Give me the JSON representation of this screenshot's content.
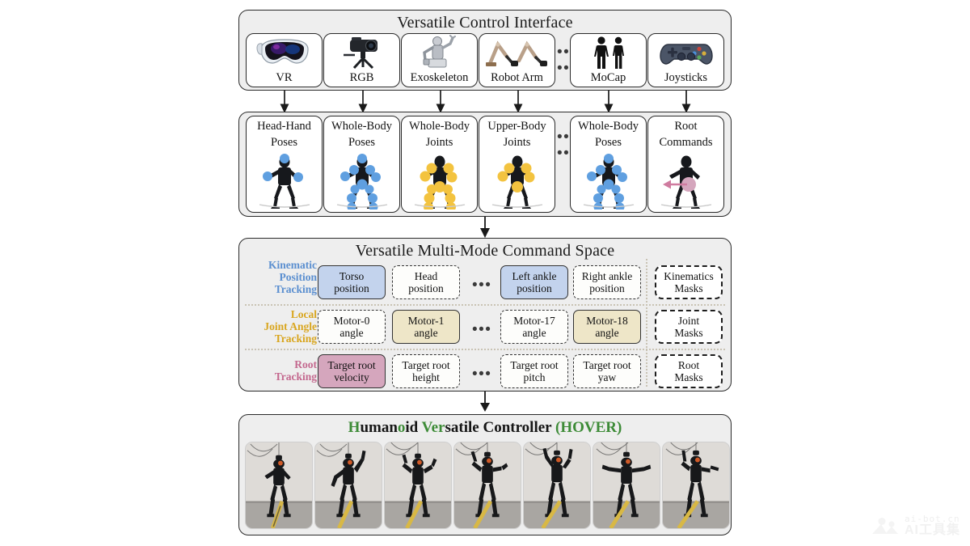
{
  "interface_panel": {
    "title": "Versatile Control Interface",
    "devices": [
      {
        "label": "VR",
        "icon": "vr-headset-icon"
      },
      {
        "label": "RGB",
        "icon": "rgb-camera-icon"
      },
      {
        "label": "Exoskeleton",
        "icon": "exoskeleton-icon"
      },
      {
        "label": "Robot Arm",
        "icon": "robot-arm-icon"
      },
      {
        "label": "MoCap",
        "icon": "mocap-suit-icon"
      },
      {
        "label": "Joysticks",
        "icon": "gamepad-icon"
      }
    ],
    "ellipsis": "•••"
  },
  "pose_panel": {
    "items": [
      {
        "line1": "Head-Hand",
        "line2": "Poses",
        "joint_color": "#5f9fe0",
        "art": "pose-head-hand"
      },
      {
        "line1": "Whole-Body",
        "line2": "Poses",
        "joint_color": "#5f9fe0",
        "art": "pose-whole-body"
      },
      {
        "line1": "Whole-Body",
        "line2": "Joints",
        "joint_color": "#f3c33f",
        "art": "pose-whole-body-joints"
      },
      {
        "line1": "Upper-Body",
        "line2": "Joints",
        "joint_color": "#f3c33f",
        "art": "pose-upper-body-joints"
      },
      {
        "line1": "Whole-Body",
        "line2": "Poses",
        "joint_color": "#5f9fe0",
        "art": "pose-whole-body"
      },
      {
        "line1": "Root",
        "line2": "Commands",
        "joint_color": "#d5a6bd",
        "art": "pose-root-commands"
      }
    ],
    "ellipsis": "•••"
  },
  "command_space": {
    "title": "Versatile Multi-Mode Command Space",
    "ellipsis": "•••",
    "rows": [
      {
        "label_lines": [
          "Kinematic",
          "Position",
          "Tracking"
        ],
        "label_color": "#5b8fd0",
        "cells": [
          {
            "line1": "Torso",
            "line2": "position",
            "style": "solid fill-blue"
          },
          {
            "line1": "Head",
            "line2": "position",
            "style": "dashed"
          },
          {
            "line1": "Left ankle",
            "line2": "position",
            "style": "solid fill-blue"
          },
          {
            "line1": "Right ankle",
            "line2": "position",
            "style": "dashed"
          }
        ],
        "mask": {
          "line1": "Kinematics",
          "line2": "Masks"
        }
      },
      {
        "label_lines": [
          "Local",
          "Joint Angle",
          "Tracking"
        ],
        "label_color": "#d9a61f",
        "cells": [
          {
            "line1": "Motor-0",
            "line2": "angle",
            "style": "dashed"
          },
          {
            "line1": "Motor-1",
            "line2": "angle",
            "style": "solid fill-cream"
          },
          {
            "line1": "Motor-17",
            "line2": "angle",
            "style": "dashed"
          },
          {
            "line1": "Motor-18",
            "line2": "angle",
            "style": "solid fill-cream"
          }
        ],
        "mask": {
          "line1": "Joint",
          "line2": "Masks"
        }
      },
      {
        "label_lines": [
          "Root",
          "Tracking"
        ],
        "label_color": "#c4698f",
        "cells": [
          {
            "line1": "Target root",
            "line2": "velocity",
            "style": "solid fill-pink"
          },
          {
            "line1": "Target root",
            "line2": "height",
            "style": "dashed"
          },
          {
            "line1": "Target root",
            "line2": "pitch",
            "style": "dashed"
          },
          {
            "line1": "Target root",
            "line2": "yaw",
            "style": "dashed"
          }
        ],
        "mask": {
          "line1": "Root",
          "line2": "Masks"
        }
      }
    ]
  },
  "controller_panel": {
    "title_parts": [
      {
        "text": "H",
        "green": true
      },
      {
        "text": "uman",
        "green": false
      },
      {
        "text": "o",
        "green": true
      },
      {
        "text": "id ",
        "green": false
      },
      {
        "text": "Ver",
        "green": true
      },
      {
        "text": "satile Controller ",
        "green": false
      },
      {
        "text": "(HOVER)",
        "green": true
      }
    ],
    "title_plain": "Humanoid Versatile Controller (HOVER)",
    "frame_count": 7,
    "frames": [
      {
        "name": "robot-frame-1",
        "pose": "arms-low"
      },
      {
        "name": "robot-frame-2",
        "pose": "right-arm-up"
      },
      {
        "name": "robot-frame-3",
        "pose": "arms-mid"
      },
      {
        "name": "robot-frame-4",
        "pose": "arms-wide"
      },
      {
        "name": "robot-frame-5",
        "pose": "both-arms-up"
      },
      {
        "name": "robot-frame-6",
        "pose": "t-pose"
      },
      {
        "name": "robot-frame-7",
        "pose": "arms-up-bent"
      }
    ]
  },
  "watermark": {
    "top": "ai-bot.cn",
    "bottom": "AI工具集"
  },
  "colors": {
    "green": "#3d8b37",
    "blue_label": "#5b8fd0",
    "gold_label": "#d9a61f",
    "pink_label": "#c4698f",
    "fill_blue": "#c3d3ed",
    "fill_cream": "#eee6c8",
    "fill_pink": "#d5a6bd",
    "panel_bg": "#eeeeee",
    "border": "#2a2a2a"
  }
}
